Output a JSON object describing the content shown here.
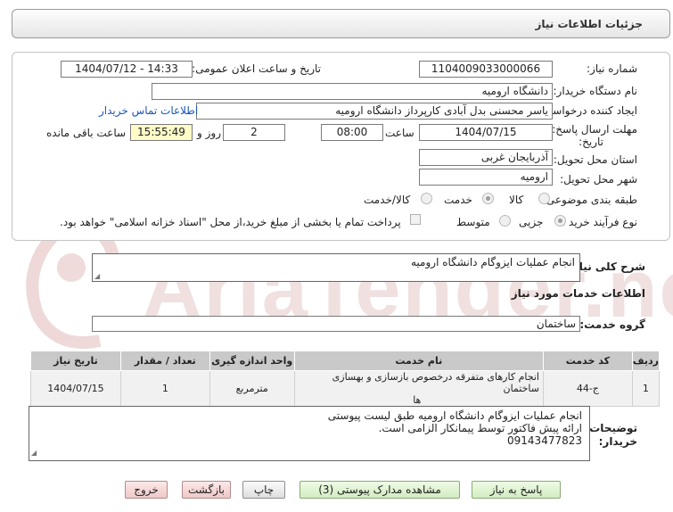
{
  "header": {
    "title": "جزئیات اطلاعات نیاز"
  },
  "form": {
    "need_number_label": "شماره نیاز:",
    "need_number": "1104009033000066",
    "announce_label": "تاریخ و ساعت اعلان عمومی:",
    "announce_value": "1404/07/12 - 14:33",
    "buyer_label": "نام دستگاه خریدار:",
    "buyer_value": "دانشگاه ارومیه",
    "creator_label": "ایجاد کننده درخواست:",
    "creator_value": "یاسر محسنی بدل آبادی کارپرداز دانشگاه ارومیه",
    "contact_link": "اطلاعات تماس خریدار",
    "deadline_label_1": "مهلت ارسال پاسخ: تا",
    "deadline_label_2": "تاریخ:",
    "deadline_date": "1404/07/15",
    "time_label": "ساعت",
    "deadline_time": "08:00",
    "days_value": "2",
    "days_label": "روز و",
    "remaining_time": "15:55:49",
    "remaining_label": "ساعت باقی مانده",
    "province_label": "استان محل تحویل:",
    "province_value": "آذربایجان غربی",
    "city_label": "شهر محل تحویل:",
    "city_value": "ارومیه",
    "category_label": "طبقه بندی موضوعی:",
    "category_options": [
      "کالا",
      "خدمت",
      "کالا/خدمت"
    ],
    "category_selected": "خدمت",
    "process_label": "نوع فرآیند خرید :",
    "process_options": [
      "جزیی",
      "متوسط"
    ],
    "process_selected": "جزیی",
    "payment_note": "پرداخت تمام یا بخشی از مبلغ خرید،از محل \"اسناد خزانه اسلامی\" خواهد بود."
  },
  "description": {
    "label": "شرح کلی نیاز:",
    "value": "انجام عملیات ایزوگام دانشگاه ارومیه"
  },
  "services": {
    "section_title": "اطلاعات خدمات مورد نیاز",
    "group_label": "گروه خدمت:",
    "group_value": "ساختمان",
    "columns": [
      "ردیف",
      "کد خدمت",
      "نام خدمت",
      "واحد اندازه گیری",
      "تعداد / مقدار",
      "تاریخ نیاز"
    ],
    "rows": [
      {
        "index": "1",
        "code": "ج-44",
        "name_line1": "انجام کارهای متفرقه درخصوص بازسازی و بهسازی ساختمان",
        "name_line2": "ها",
        "unit": "مترمربع",
        "quantity": "1",
        "date": "1404/07/15"
      }
    ]
  },
  "buyer_notes": {
    "label_1": "توضیحات",
    "label_2": "خریدار:",
    "line1": "انجام عملیات ایزوگام دانشگاه ارومیه طبق لیست پیوستی",
    "line2": "ارائه پیش فاکتور توسط پیمانکار الزامی است.",
    "line3": "09143477823"
  },
  "buttons": {
    "reply": "پاسخ به نیاز",
    "attachments": "مشاهده مدارک پیوستی (3)",
    "print": "چاپ",
    "back": "بازگشت",
    "exit": "خروج"
  },
  "watermark": {
    "text": "AriaTender.net",
    "color": "#e9c9c9"
  }
}
